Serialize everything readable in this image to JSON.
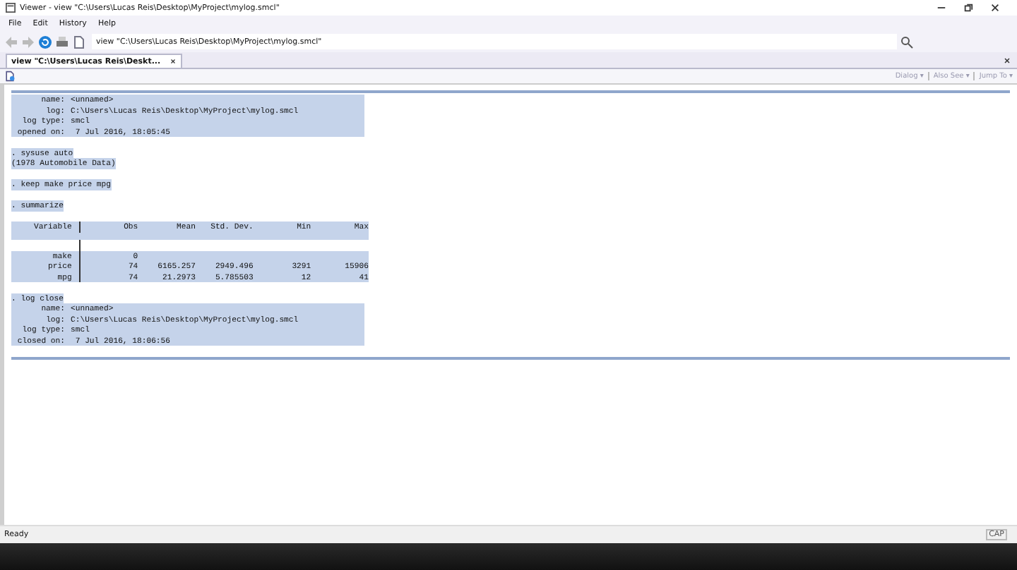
{
  "window": {
    "title": "Viewer - view \"C:\\Users\\Lucas Reis\\Desktop\\MyProject\\mylog.smcl\""
  },
  "menu": [
    "File",
    "Edit",
    "History",
    "Help"
  ],
  "toolbar": {
    "address": "view \"C:\\Users\\Lucas Reis\\Desktop\\MyProject\\mylog.smcl\""
  },
  "tab": {
    "label": "view \"C:\\Users\\Lucas Reis\\Deskt...",
    "selected": true
  },
  "viewer_links": [
    "Dialog ▾",
    "Also See ▾",
    "Jump To ▾"
  ],
  "log": {
    "selected": true,
    "blocks": [
      {
        "kind": "fields",
        "rows": [
          {
            "label": "name:",
            "value": "<unnamed>"
          },
          {
            "label": "log:",
            "value": "C:\\Users\\Lucas Reis\\Desktop\\MyProject\\mylog.smcl"
          },
          {
            "label": "log type:",
            "value": "smcl"
          },
          {
            "label": "opened on:",
            "value": " 7 Jul 2016, 18:05:45"
          }
        ]
      },
      {
        "kind": "command",
        "text": ". sysuse auto",
        "output": "(1978 Automobile Data)"
      },
      {
        "kind": "command",
        "text": ". keep make price mpg"
      },
      {
        "kind": "command",
        "text": ". summarize"
      },
      {
        "kind": "table",
        "columns": [
          "Variable",
          "Obs",
          "Mean",
          "Std. Dev.",
          "Min",
          "Max"
        ],
        "rows": [
          [
            "make",
            "0",
            "",
            "",
            "",
            ""
          ],
          [
            "price",
            "74",
            "6165.257",
            "2949.496",
            "3291",
            "15906"
          ],
          [
            "mpg",
            "74",
            "21.2973",
            "5.785503",
            "12",
            "41"
          ]
        ]
      },
      {
        "kind": "fields",
        "command": ". log close",
        "rows": [
          {
            "label": "name:",
            "value": "<unnamed>"
          },
          {
            "label": "log:",
            "value": "C:\\Users\\Lucas Reis\\Desktop\\MyProject\\mylog.smcl"
          },
          {
            "label": "log type:",
            "value": "smcl"
          },
          {
            "label": "closed on:",
            "value": " 7 Jul 2016, 18:06:56"
          }
        ]
      }
    ]
  },
  "status_bar": {
    "text": "Ready",
    "indicator": "CAP"
  }
}
